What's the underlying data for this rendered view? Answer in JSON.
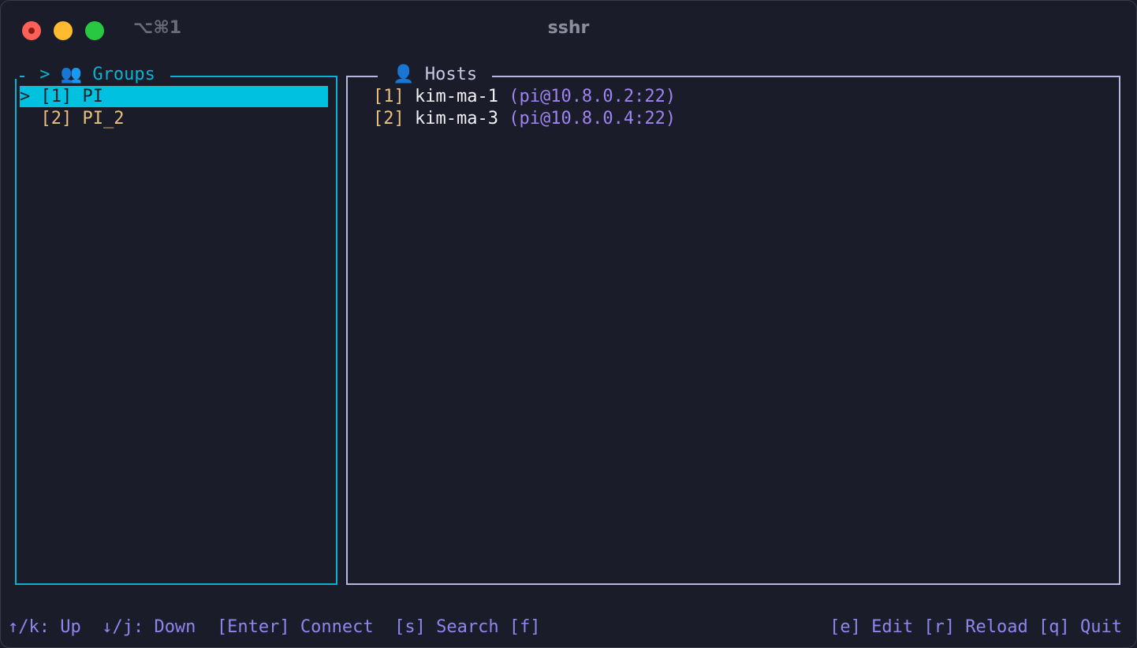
{
  "window": {
    "title": "sshr",
    "shortcut": "⌥⌘1"
  },
  "groups": {
    "title": " > 👥 Groups ",
    "items": [
      {
        "marker": "> ",
        "index": "[1]",
        "name": "PI",
        "selected": true
      },
      {
        "marker": "  ",
        "index": "[2]",
        "name": "PI_2",
        "selected": false
      }
    ]
  },
  "hosts": {
    "title": " 👤 Hosts ",
    "items": [
      {
        "index": "[1]",
        "name": "kim-ma-1",
        "address": "(pi@10.8.0.2:22)"
      },
      {
        "index": "[2]",
        "name": "kim-ma-3",
        "address": "(pi@10.8.0.4:22)"
      }
    ]
  },
  "footer": {
    "left": [
      {
        "label": "↑/k: Up"
      },
      {
        "label": "↓/j: Down"
      },
      {
        "label": "[Enter] Connect"
      },
      {
        "label": "[s] Search [f]"
      }
    ],
    "right": [
      {
        "label": "[e] Edit"
      },
      {
        "label": "[r] Reload"
      },
      {
        "label": "[q] Quit"
      }
    ]
  },
  "colors": {
    "background": "#1b1c2a",
    "groups_border": "#0ab3cf",
    "hosts_border": "#b6b8de",
    "selection": "#00c2e0",
    "index": "#e8c080",
    "address": "#9d84f0",
    "footer": "#8e86f0"
  }
}
